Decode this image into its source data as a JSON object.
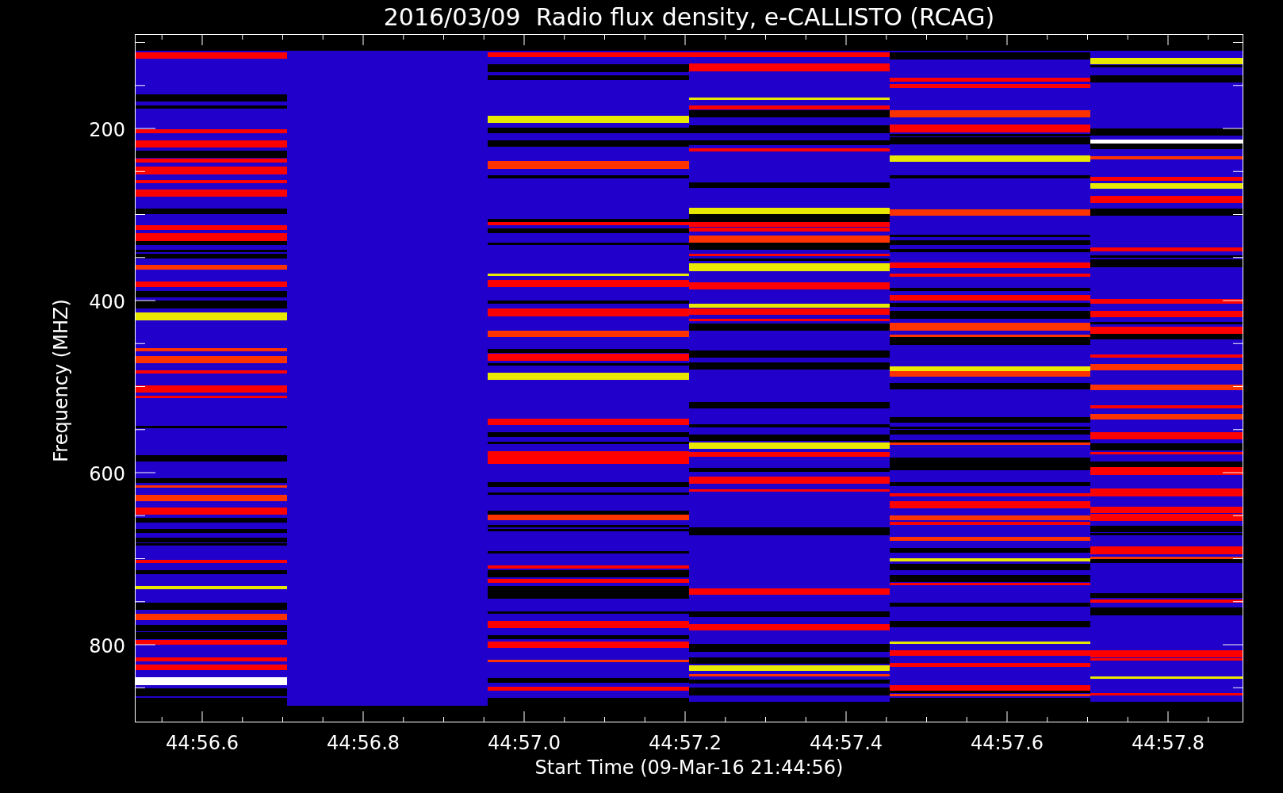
{
  "title": "2016/03/09  Radio flux density, e-CALLISTO (RCAG)",
  "y_axis": {
    "label": "Frequency (MHZ)",
    "ticks": [
      "200",
      "400",
      "600",
      "800"
    ]
  },
  "x_axis": {
    "label": "Start Time (09-Mar-16 21:44:56)",
    "ticks": [
      "44:56.6",
      "44:56.8",
      "44:57.0",
      "44:57.2",
      "44:57.4",
      "44:57.6",
      "44:57.8"
    ]
  }
}
